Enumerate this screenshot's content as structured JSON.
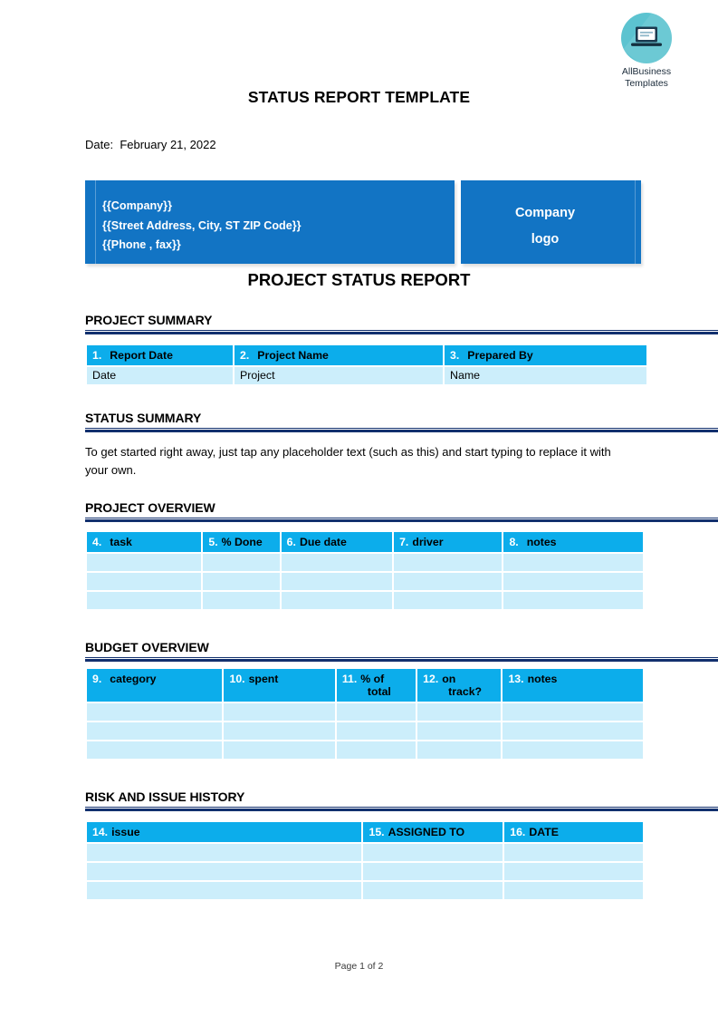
{
  "brand": {
    "icon": "laptop-icon",
    "name_line1": "AllBusiness",
    "name_line2": "Templates",
    "circle_color": "#5cc3d0"
  },
  "document": {
    "title": "STATUS REPORT TEMPLATE",
    "date_label": "Date:",
    "date_value": "February 21, 2022",
    "report_heading": "PROJECT STATUS REPORT",
    "footer": "Page 1 of 2"
  },
  "company_header": {
    "line1": "{{Company}}",
    "line2": "{{Street Address, City, ST ZIP Code}}",
    "line3": "{{Phone , fax}}",
    "logo_line1": "Company",
    "logo_line2": "logo",
    "background_color": "#1274c4"
  },
  "colors": {
    "header_row": "#0cadeb",
    "body_row": "#cceefb",
    "rule": "#12306e",
    "band": "#1274c4"
  },
  "sections": {
    "project_summary": {
      "title": "PROJECT SUMMARY",
      "table": {
        "headers": [
          {
            "num": "1.",
            "label": "Report Date"
          },
          {
            "num": "2.",
            "label": "Project Name"
          },
          {
            "num": "3.",
            "label": "Prepared By"
          }
        ],
        "rows": [
          [
            "Date",
            "Project",
            "Name"
          ]
        ]
      }
    },
    "status_summary": {
      "title": "STATUS SUMMARY",
      "text": "To get started right away, just tap any placeholder text (such as this) and start typing to replace it with your own."
    },
    "project_overview": {
      "title": "PROJECT OVERVIEW",
      "table": {
        "headers": [
          {
            "num": "4.",
            "label": "task"
          },
          {
            "num": "5.",
            "label": "% Done"
          },
          {
            "num": "6.",
            "label": "Due date"
          },
          {
            "num": "7.",
            "label": "driver"
          },
          {
            "num": "8.",
            "label": "notes"
          }
        ],
        "rows": [
          [
            "",
            "",
            "",
            "",
            ""
          ],
          [
            "",
            "",
            "",
            "",
            ""
          ],
          [
            "",
            "",
            "",
            "",
            ""
          ]
        ]
      }
    },
    "budget_overview": {
      "title": "BUDGET OVERVIEW",
      "table": {
        "headers": [
          {
            "num": "9.",
            "label": "category",
            "label2": ""
          },
          {
            "num": "10.",
            "label": "spent",
            "label2": ""
          },
          {
            "num": "11.",
            "label": "% of",
            "label2": "total"
          },
          {
            "num": "12.",
            "label": "on",
            "label2": "track?"
          },
          {
            "num": "13.",
            "label": "notes",
            "label2": ""
          }
        ],
        "rows": [
          [
            "",
            "",
            "",
            "",
            ""
          ],
          [
            "",
            "",
            "",
            "",
            ""
          ],
          [
            "",
            "",
            "",
            "",
            ""
          ]
        ]
      }
    },
    "risk_and_issue_history": {
      "title": "RISK AND ISSUE HISTORY",
      "table": {
        "headers": [
          {
            "num": "14.",
            "label": "issue"
          },
          {
            "num": "15.",
            "label": "ASSIGNED TO"
          },
          {
            "num": "16.",
            "label": "DATE"
          }
        ],
        "rows": [
          [
            "",
            "",
            ""
          ],
          [
            "",
            "",
            ""
          ],
          [
            "",
            "",
            ""
          ]
        ]
      }
    }
  }
}
